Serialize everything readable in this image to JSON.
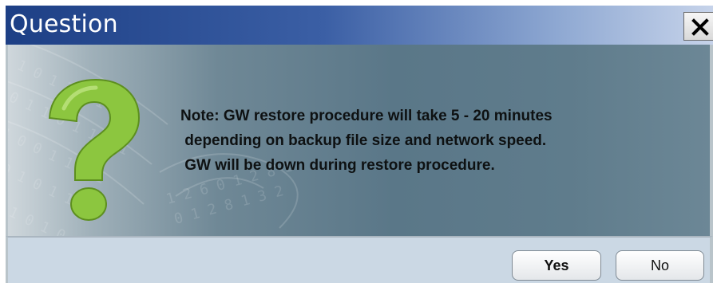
{
  "dialog": {
    "title": "Question",
    "close_icon": "close-icon",
    "question_icon": "question-mark-icon",
    "message_lines": [
      "Note: GW restore procedure will take 5 - 20 minutes",
      " depending on backup file size and network speed.",
      " GW will be down during restore procedure."
    ],
    "buttons": {
      "yes_label": "Yes",
      "no_label": "No"
    },
    "colors": {
      "titlebar": "#1d3f85",
      "question_mark": "#8cc63f",
      "text": "#0e1112"
    }
  }
}
